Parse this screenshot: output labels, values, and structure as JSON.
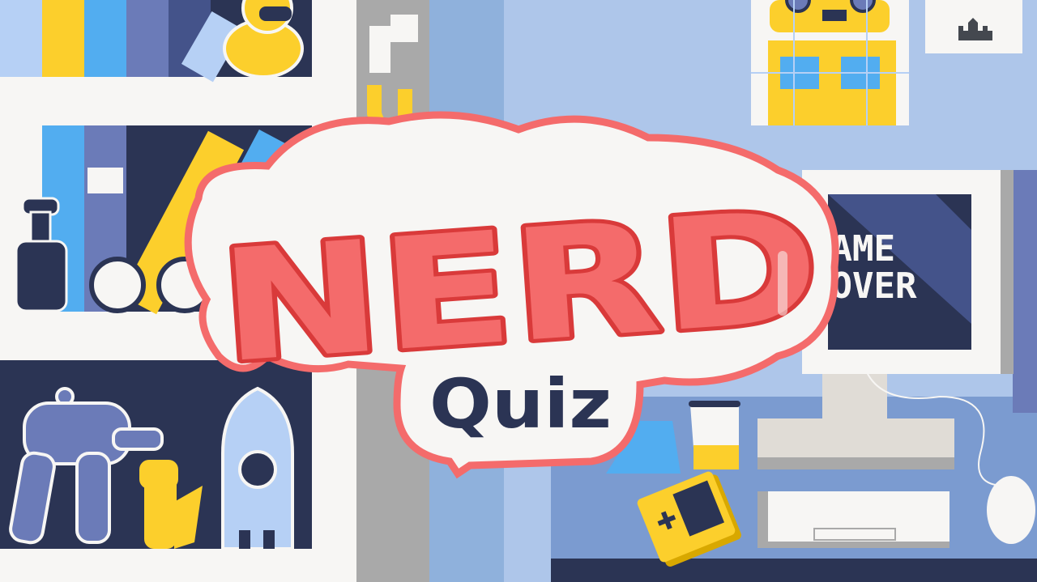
{
  "logo": {
    "title": "NERD",
    "subtitle": "Quiz"
  },
  "monitor": {
    "line1": "GAME",
    "line2": "OVER",
    "visible_line1": "ME",
    "visible_line2": "VER"
  },
  "colors": {
    "wall": "#aec6ea",
    "navy": "#2b3454",
    "shelf": "#f7f6f4",
    "logo_red": "#f46b6b",
    "logo_dark_red": "#d93a3a",
    "yellow": "#fccf2c",
    "purple": "#6b7bb8"
  }
}
